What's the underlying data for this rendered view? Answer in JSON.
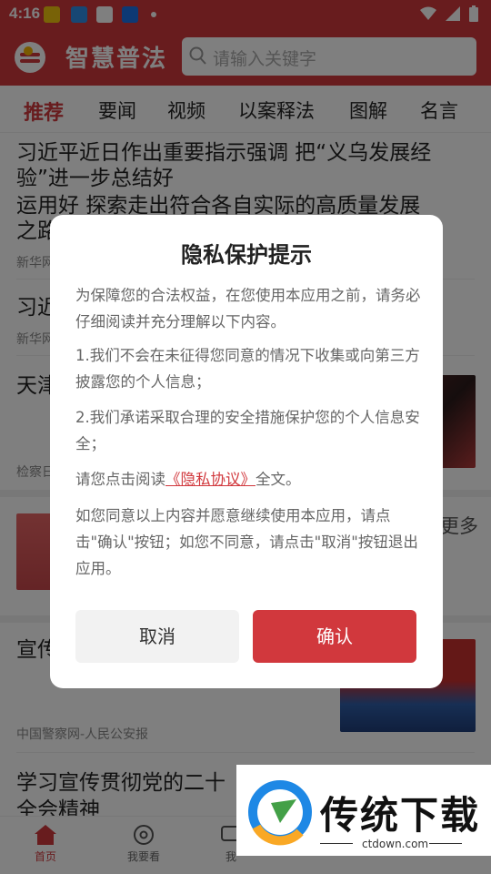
{
  "status_bar": {
    "time": "4:16"
  },
  "header": {
    "app_title": "智慧普法",
    "search_placeholder": "请输入关键字"
  },
  "tabs": [
    "推荐",
    "要闻",
    "视频",
    "以案释法",
    "图解",
    "名言"
  ],
  "feed": {
    "item1": {
      "title_line1": "习近平近日作出重要指示强调 把“义乌发展经",
      "title_line2": "验”进一步总结好",
      "title_line3": "运用好 探索走出符合各自实际的高质量发展",
      "title_line4": "之路",
      "source": "新华网"
    },
    "item2": {
      "title": "习近",
      "source": "新华网"
    },
    "item3": {
      "title": "天津",
      "source": "检察日"
    },
    "item4": {
      "more": "更多"
    },
    "item5": {
      "title": "宣传",
      "source": "中国警察网-人民公安报"
    },
    "item6": {
      "title_line1": "学习宣传贯彻党的二十",
      "title_line2": "全会精神"
    }
  },
  "bottom_nav": [
    {
      "label": "首页",
      "active": true
    },
    {
      "label": "我要看",
      "active": false
    },
    {
      "label": "我",
      "active": false
    }
  ],
  "dialog": {
    "title": "隐私保护提示",
    "p1": "为保障您的合法权益，在您使用本应用之前，请务必仔细阅读并充分理解以下内容。",
    "p2": "1.我们不会在未征得您同意的情况下收集或向第三方披露您的个人信息；",
    "p3": "2.我们承诺采取合理的安全措施保护您的个人信息安全；",
    "p4_before": "请您点击阅读",
    "p4_link": "《隐私协议》",
    "p4_after": "全文。",
    "p5": "如您同意以上内容并愿意继续使用本应用，请点击\"确认\"按钮；如您不同意，请点击\"取消\"按钮退出应用。",
    "cancel": "取消",
    "confirm": "确认"
  },
  "watermark": {
    "text": "传统下载",
    "url": "ctdown.com"
  },
  "colors": {
    "brand_red": "#d1383d"
  }
}
